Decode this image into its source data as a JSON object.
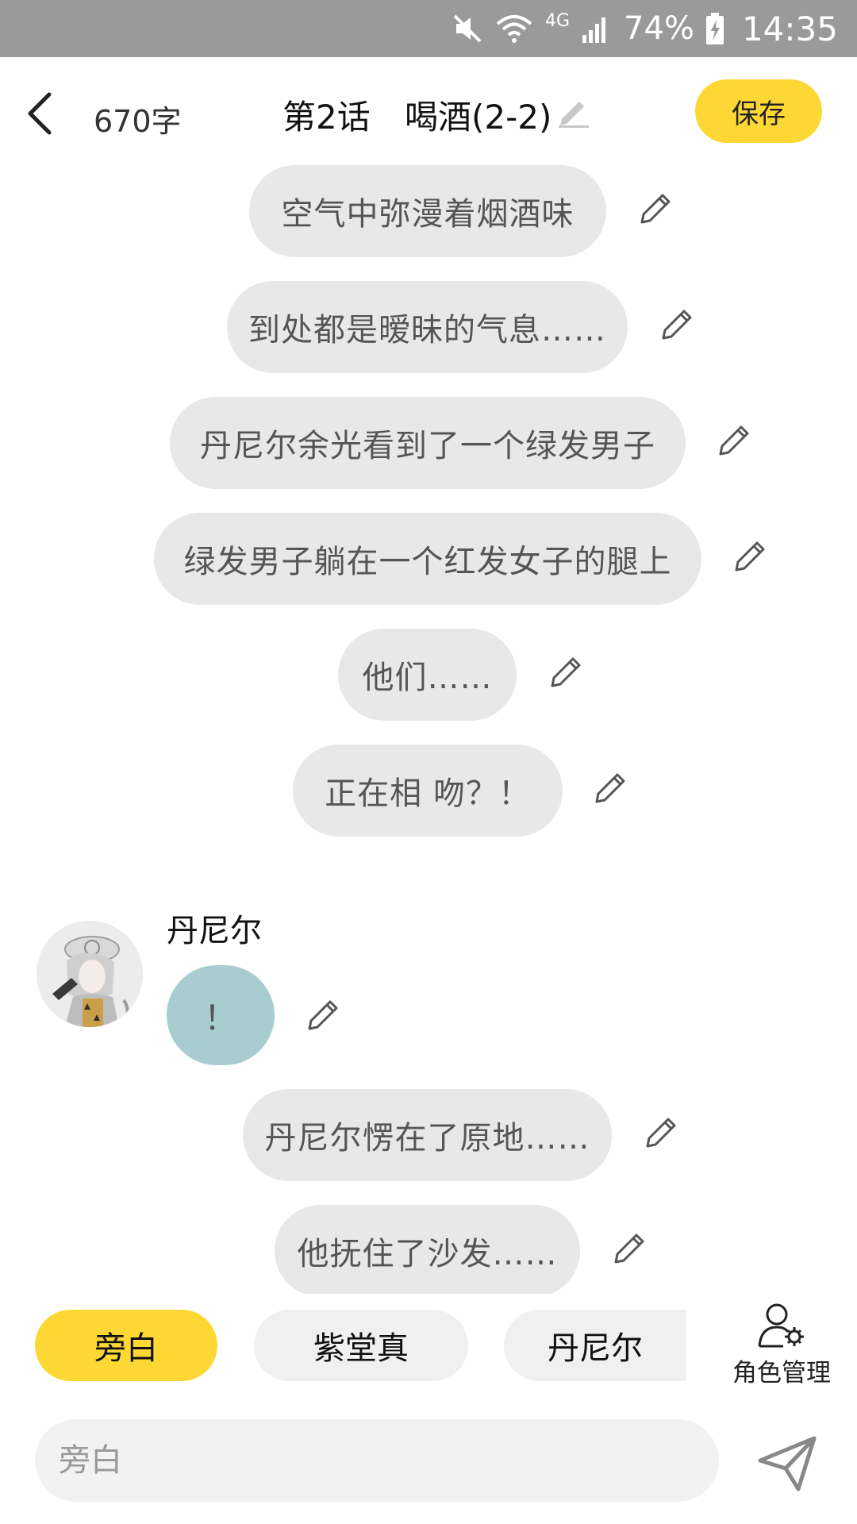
{
  "status_bar": {
    "battery_percent": "74%",
    "time": "14:35",
    "network": "4G",
    "icons": [
      "mute-icon",
      "wifi-icon",
      "signal-icon",
      "battery-charging-icon"
    ]
  },
  "header": {
    "word_count": "670字",
    "episode": "第2话",
    "chapter_title": "喝酒(2-2)",
    "save_label": "保存"
  },
  "messages": [
    {
      "type": "narration",
      "text": "空气中弥漫着烟酒味"
    },
    {
      "type": "narration",
      "text": "到处都是暧昧的气息……"
    },
    {
      "type": "narration",
      "text": "丹尼尔余光看到了一个绿发男子"
    },
    {
      "type": "narration",
      "text": "绿发男子躺在一个红发女子的腿上"
    },
    {
      "type": "narration",
      "text": "他们……"
    },
    {
      "type": "narration",
      "text": "正在相 吻？！"
    },
    {
      "type": "character",
      "speaker": "丹尼尔",
      "text": "！"
    },
    {
      "type": "narration",
      "text": "丹尼尔愣在了原地……"
    },
    {
      "type": "narration",
      "text": "他抚住了沙发……"
    }
  ],
  "roles": {
    "items": [
      "旁白",
      "紫堂真",
      "丹尼尔"
    ],
    "active_index": 0,
    "manage_label": "角色管理"
  },
  "input": {
    "placeholder": "旁白"
  },
  "colors": {
    "accent": "#fdd835",
    "bubble": "#e8e8e8",
    "character_bubble": "#a9ccd1",
    "status_bar": "#9a9a9a"
  }
}
